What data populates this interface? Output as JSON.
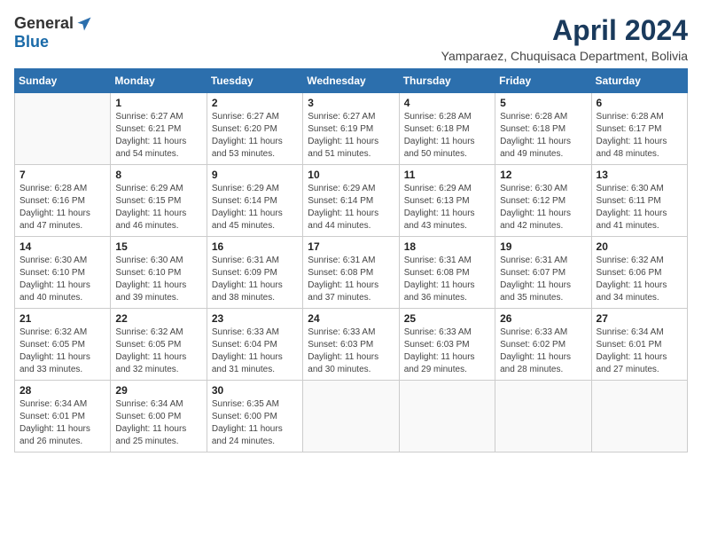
{
  "logo": {
    "general": "General",
    "blue": "Blue"
  },
  "title": "April 2024",
  "location": "Yamparaez, Chuquisaca Department, Bolivia",
  "days_of_week": [
    "Sunday",
    "Monday",
    "Tuesday",
    "Wednesday",
    "Thursday",
    "Friday",
    "Saturday"
  ],
  "weeks": [
    [
      {
        "day": "",
        "info": ""
      },
      {
        "day": "1",
        "info": "Sunrise: 6:27 AM\nSunset: 6:21 PM\nDaylight: 11 hours\nand 54 minutes."
      },
      {
        "day": "2",
        "info": "Sunrise: 6:27 AM\nSunset: 6:20 PM\nDaylight: 11 hours\nand 53 minutes."
      },
      {
        "day": "3",
        "info": "Sunrise: 6:27 AM\nSunset: 6:19 PM\nDaylight: 11 hours\nand 51 minutes."
      },
      {
        "day": "4",
        "info": "Sunrise: 6:28 AM\nSunset: 6:18 PM\nDaylight: 11 hours\nand 50 minutes."
      },
      {
        "day": "5",
        "info": "Sunrise: 6:28 AM\nSunset: 6:18 PM\nDaylight: 11 hours\nand 49 minutes."
      },
      {
        "day": "6",
        "info": "Sunrise: 6:28 AM\nSunset: 6:17 PM\nDaylight: 11 hours\nand 48 minutes."
      }
    ],
    [
      {
        "day": "7",
        "info": "Sunrise: 6:28 AM\nSunset: 6:16 PM\nDaylight: 11 hours\nand 47 minutes."
      },
      {
        "day": "8",
        "info": "Sunrise: 6:29 AM\nSunset: 6:15 PM\nDaylight: 11 hours\nand 46 minutes."
      },
      {
        "day": "9",
        "info": "Sunrise: 6:29 AM\nSunset: 6:14 PM\nDaylight: 11 hours\nand 45 minutes."
      },
      {
        "day": "10",
        "info": "Sunrise: 6:29 AM\nSunset: 6:14 PM\nDaylight: 11 hours\nand 44 minutes."
      },
      {
        "day": "11",
        "info": "Sunrise: 6:29 AM\nSunset: 6:13 PM\nDaylight: 11 hours\nand 43 minutes."
      },
      {
        "day": "12",
        "info": "Sunrise: 6:30 AM\nSunset: 6:12 PM\nDaylight: 11 hours\nand 42 minutes."
      },
      {
        "day": "13",
        "info": "Sunrise: 6:30 AM\nSunset: 6:11 PM\nDaylight: 11 hours\nand 41 minutes."
      }
    ],
    [
      {
        "day": "14",
        "info": "Sunrise: 6:30 AM\nSunset: 6:10 PM\nDaylight: 11 hours\nand 40 minutes."
      },
      {
        "day": "15",
        "info": "Sunrise: 6:30 AM\nSunset: 6:10 PM\nDaylight: 11 hours\nand 39 minutes."
      },
      {
        "day": "16",
        "info": "Sunrise: 6:31 AM\nSunset: 6:09 PM\nDaylight: 11 hours\nand 38 minutes."
      },
      {
        "day": "17",
        "info": "Sunrise: 6:31 AM\nSunset: 6:08 PM\nDaylight: 11 hours\nand 37 minutes."
      },
      {
        "day": "18",
        "info": "Sunrise: 6:31 AM\nSunset: 6:08 PM\nDaylight: 11 hours\nand 36 minutes."
      },
      {
        "day": "19",
        "info": "Sunrise: 6:31 AM\nSunset: 6:07 PM\nDaylight: 11 hours\nand 35 minutes."
      },
      {
        "day": "20",
        "info": "Sunrise: 6:32 AM\nSunset: 6:06 PM\nDaylight: 11 hours\nand 34 minutes."
      }
    ],
    [
      {
        "day": "21",
        "info": "Sunrise: 6:32 AM\nSunset: 6:05 PM\nDaylight: 11 hours\nand 33 minutes."
      },
      {
        "day": "22",
        "info": "Sunrise: 6:32 AM\nSunset: 6:05 PM\nDaylight: 11 hours\nand 32 minutes."
      },
      {
        "day": "23",
        "info": "Sunrise: 6:33 AM\nSunset: 6:04 PM\nDaylight: 11 hours\nand 31 minutes."
      },
      {
        "day": "24",
        "info": "Sunrise: 6:33 AM\nSunset: 6:03 PM\nDaylight: 11 hours\nand 30 minutes."
      },
      {
        "day": "25",
        "info": "Sunrise: 6:33 AM\nSunset: 6:03 PM\nDaylight: 11 hours\nand 29 minutes."
      },
      {
        "day": "26",
        "info": "Sunrise: 6:33 AM\nSunset: 6:02 PM\nDaylight: 11 hours\nand 28 minutes."
      },
      {
        "day": "27",
        "info": "Sunrise: 6:34 AM\nSunset: 6:01 PM\nDaylight: 11 hours\nand 27 minutes."
      }
    ],
    [
      {
        "day": "28",
        "info": "Sunrise: 6:34 AM\nSunset: 6:01 PM\nDaylight: 11 hours\nand 26 minutes."
      },
      {
        "day": "29",
        "info": "Sunrise: 6:34 AM\nSunset: 6:00 PM\nDaylight: 11 hours\nand 25 minutes."
      },
      {
        "day": "30",
        "info": "Sunrise: 6:35 AM\nSunset: 6:00 PM\nDaylight: 11 hours\nand 24 minutes."
      },
      {
        "day": "",
        "info": ""
      },
      {
        "day": "",
        "info": ""
      },
      {
        "day": "",
        "info": ""
      },
      {
        "day": "",
        "info": ""
      }
    ]
  ]
}
